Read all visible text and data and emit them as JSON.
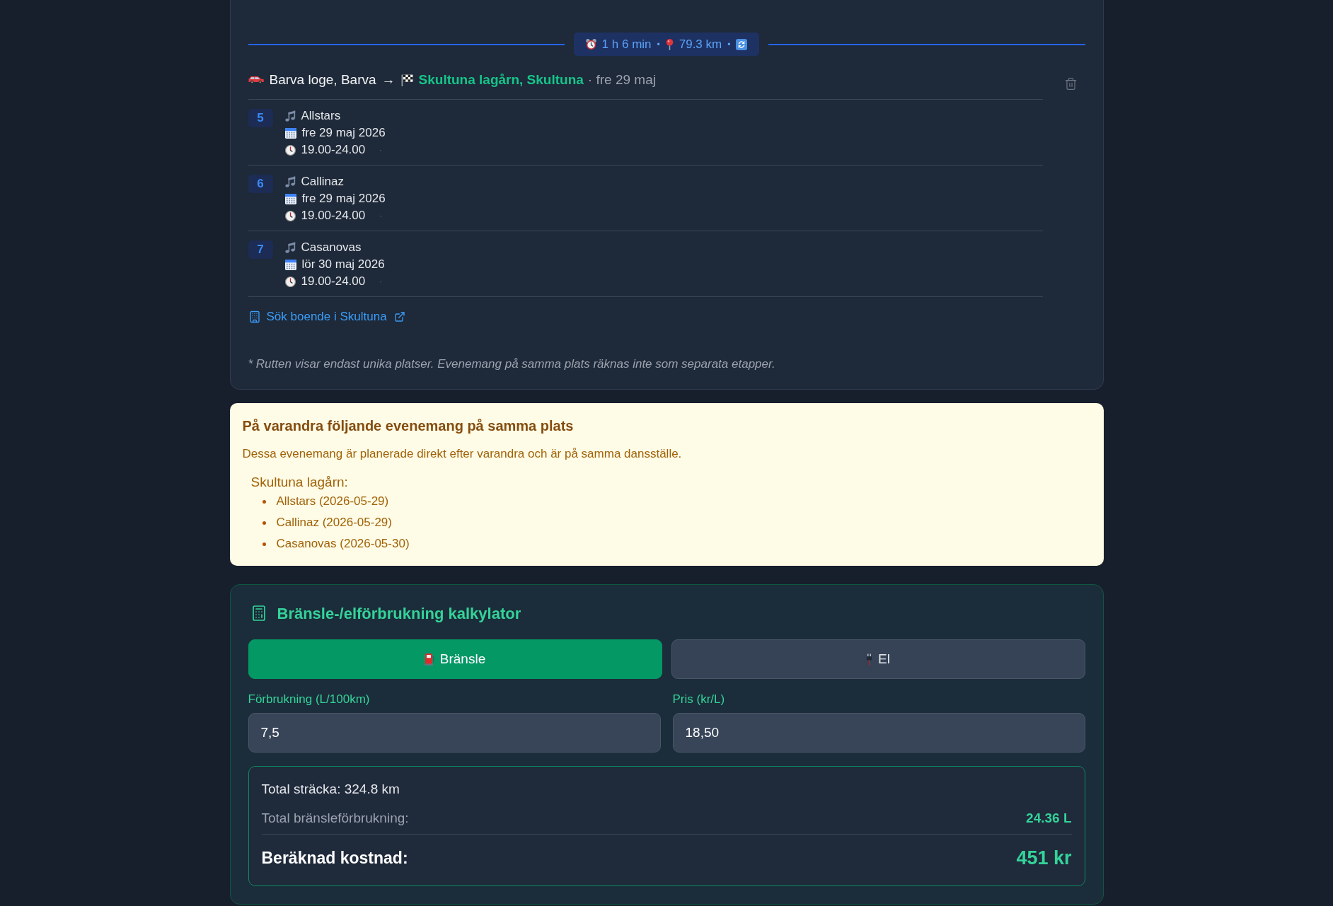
{
  "route_leg": {
    "travel": {
      "duration": "1 h 6 min",
      "separator_1": "•",
      "distance": "79.3 km",
      "separator_2": "•"
    },
    "from": "Barva loge, Barva",
    "arrow": "→",
    "to": "Skultuna lagårn, Skultuna",
    "date": "· fre 29 maj",
    "stops": [
      {
        "number": "5",
        "name": "Allstars",
        "date": "fre 29 maj 2026",
        "time": "19.00-24.00",
        "separator": "·"
      },
      {
        "number": "6",
        "name": "Callinaz",
        "date": "fre 29 maj 2026",
        "time": "19.00-24.00",
        "separator": "·"
      },
      {
        "number": "7",
        "name": "Casanovas",
        "date": "lör 30 maj 2026",
        "time": "19.00-24.00",
        "separator": "·"
      }
    ],
    "lodging_link": "Sök boende i Skultuna"
  },
  "footnote": "* Rutten visar endast unika platser. Evenemang på samma plats räknas inte som separata etapper.",
  "notice": {
    "title": "På varandra följande evenemang på samma plats",
    "description": "Dessa evenemang är planerade direkt efter varandra och är på samma dansställe.",
    "venue": "Skultuna lagårn:",
    "events": [
      "Allstars (2026-05-29)",
      "Callinaz (2026-05-29)",
      "Casanovas (2026-05-30)"
    ]
  },
  "calculator": {
    "title": "Bränsle-/elförbrukning kalkylator",
    "modes": [
      {
        "kind": "fuel",
        "label": "Bränsle",
        "selected": true
      },
      {
        "kind": "electric",
        "label": "El",
        "selected": false
      }
    ],
    "fields": [
      {
        "label": "Förbrukning (L/100km)",
        "value": "7,5"
      },
      {
        "label": "Pris (kr/L)",
        "value": "18,50"
      }
    ],
    "summary": {
      "distance": "Total sträcka: 324.8 km",
      "consumption_label": "Total bränsleförbrukning:",
      "consumption_value": "24.36 L",
      "cost_label": "Beräknad kostnad:",
      "cost_value": "451 kr"
    }
  }
}
